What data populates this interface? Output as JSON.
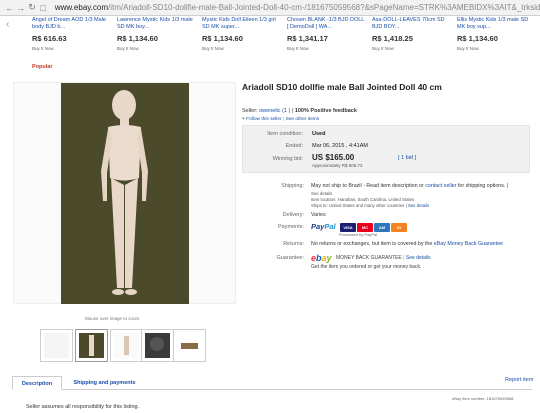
{
  "browser": {
    "url_scheme": "www.ebay.com",
    "url_path": "/itm/Ariadoll-SD10-dollfie-male-Ball-Jointed-Doll-40-cm-/181675059568?&sPageName=STRK%3AMEBIDX%3AIT&_trksid=p2047675"
  },
  "carousel": {
    "items": [
      {
        "title": "Angel of Dream AOD 1/3 Male body BJD b...",
        "price": "R$ 616.63",
        "buy": "Buy It Now"
      },
      {
        "title": "Lawrence Mystic Kids 1/3 male SD MK boy...",
        "price": "R$ 1,134.60",
        "buy": "Buy It Now"
      },
      {
        "title": "Mystic Kids Doll Eileen 1/3 girl SD MK super...",
        "price": "R$ 1,134.60",
        "buy": "Buy It Now"
      },
      {
        "title": "Chosen BLANK -1/3 BJD DOLL [ DemoDoll ] WA...",
        "price": "R$ 1,341.17",
        "buy": "Buy It Now"
      },
      {
        "title": "Asa-DOLL-LEAVES 70cm SD BJD BOY...",
        "price": "R$ 1,418.25",
        "buy": "Buy It Now"
      },
      {
        "title": "Ellis Mystic Kids 1/3 male SD MK boy sup...",
        "price": "R$ 1,134.60",
        "buy": "Buy It Now"
      }
    ]
  },
  "popular": "Popular",
  "zoom_hint": "Mouse over image to zoom",
  "item": {
    "title": "Ariadoll SD10 dollfie male Ball Jointed Doll 40 cm",
    "seller_label": "Seller:",
    "seller_name": "owenelic",
    "seller_score": "(1 )",
    "seller_feedback": "100% Positive feedback",
    "follow": "Follow this seller",
    "see_other": "See other items",
    "condition_label": "Item condition:",
    "condition": "Used",
    "ended_label": "Ended:",
    "ended": "Mar 06, 2015 , 4:41AM",
    "winning_label": "Winning bid:",
    "winning_price": "US $165.00",
    "approx": "Approximately R$ 506.72",
    "bids": "[ 1 bid ]"
  },
  "details": {
    "shipping_label": "Shipping:",
    "shipping_text": "May not ship to Brazil - Read item description or",
    "shipping_link": "contact seller",
    "shipping_tail": "for shipping options. |",
    "see_details": "See details",
    "item_location": "Item location:  Hanahan, South Carolina, United States",
    "ships_to": "Ships to:  United States and many other countries |",
    "ships_to_link": "See details",
    "delivery_label": "Delivery:",
    "delivery": "Varies",
    "payments_label": "Payments:",
    "paypal_note": "Processed by PayPal",
    "returns_label": "Returns:",
    "returns": "No returns or exchanges, but item is covered by the",
    "returns_link": "eBay Money Back Guarantee",
    "guarantee_label": "Guarantee:",
    "guarantee_title": "MONEY BACK GUARANTEE",
    "guarantee_details": "See details",
    "guarantee_sub": "Get the item you ordered or get your money back."
  },
  "tabs": {
    "description": "Description",
    "shipping": "Shipping and payments",
    "report": "Report item",
    "item_number": "eBay item number:  181675059568",
    "disclaimer": "Seller assumes all responsibility for this listing."
  },
  "colors": {
    "link": "#1a4ea8",
    "popular": "#c0392b",
    "photo_bg": "#4b4a2a"
  }
}
